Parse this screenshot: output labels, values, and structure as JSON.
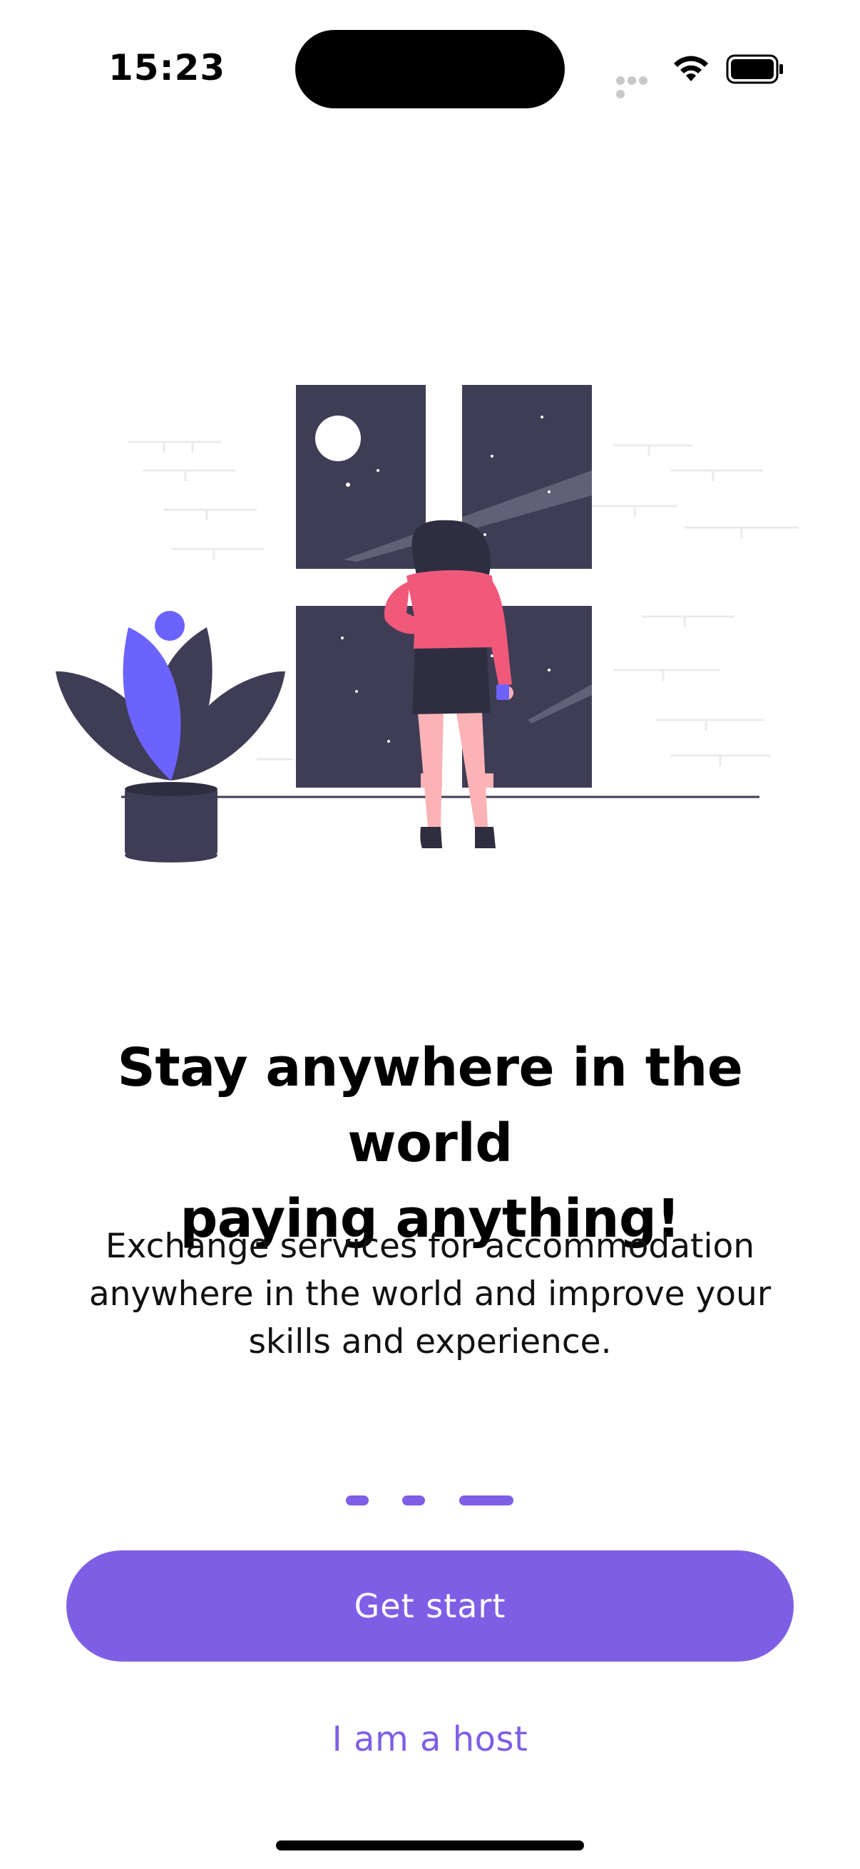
{
  "status_bar": {
    "time": "15:23",
    "icons": [
      "cellular-signal-icon",
      "wifi-icon",
      "battery-icon"
    ]
  },
  "illustration": {
    "subject": "woman-looking-out-window-illustration",
    "colors": {
      "dark": "#3f3d56",
      "accent": "#6c63ff",
      "shirt": "#f0597a",
      "skin": "#fbb3b6"
    }
  },
  "onboarding": {
    "title_line1": "Stay anywhere in the world",
    "title_line2": "paying anything!",
    "subtitle_line1": "Exchange services for accommodation",
    "subtitle_line2": "anywhere in the world and improve your",
    "subtitle_line3": "skills and experience.",
    "page_count": 3,
    "active_page": 3
  },
  "actions": {
    "primary_label": "Get start",
    "secondary_label": "I am a host"
  },
  "colors": {
    "accent": "#7f5ee6",
    "text": "#000000",
    "background": "#ffffff"
  }
}
